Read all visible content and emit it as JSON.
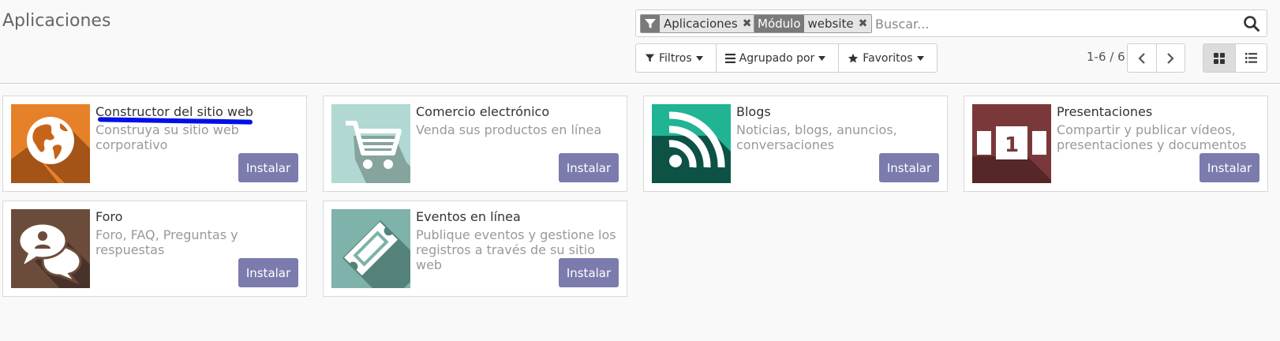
{
  "header": {
    "title": "Aplicaciones"
  },
  "search": {
    "facets": [
      {
        "label": "",
        "value": "Aplicaciones",
        "icon": "filter-icon"
      },
      {
        "label": "Módulo",
        "value": "website",
        "icon": ""
      }
    ],
    "placeholder": "Buscar..."
  },
  "controls": {
    "filters_label": "Filtros",
    "groupby_label": "Agrupado por",
    "favorites_label": "Favoritos"
  },
  "pager": {
    "value": "1-6 / 6"
  },
  "colors": {
    "install_button": "#7c7bad",
    "annotation_stroke": "#0010e8"
  },
  "apps": [
    {
      "title": "Constructor del sitio web",
      "description": "Construya su sitio web corporativo",
      "button": "Instalar",
      "icon": "globe-icon",
      "color": "#e6812a"
    },
    {
      "title": "Comercio electrónico",
      "description": "Venda sus productos en línea",
      "button": "Instalar",
      "icon": "cart-icon",
      "color": "#b1d8d2"
    },
    {
      "title": "Blogs",
      "description": "Noticias, blogs, anuncios, conversaciones",
      "button": "Instalar",
      "icon": "rss-icon",
      "color": "#20b394"
    },
    {
      "title": "Presentaciones",
      "description": "Compartir y publicar vídeos, presentaciones y documentos",
      "button": "Instalar",
      "icon": "slides-icon",
      "color": "#7b383a"
    },
    {
      "title": "Foro",
      "description": "Foro, FAQ, Preguntas y respuestas",
      "button": "Instalar",
      "icon": "chat-bubbles-icon",
      "color": "#6b4c3b"
    },
    {
      "title": "Eventos en línea",
      "description": "Publique eventos y gestione los registros a través de su sitio web",
      "button": "Instalar",
      "icon": "ticket-icon",
      "color": "#7eb2aa"
    }
  ]
}
